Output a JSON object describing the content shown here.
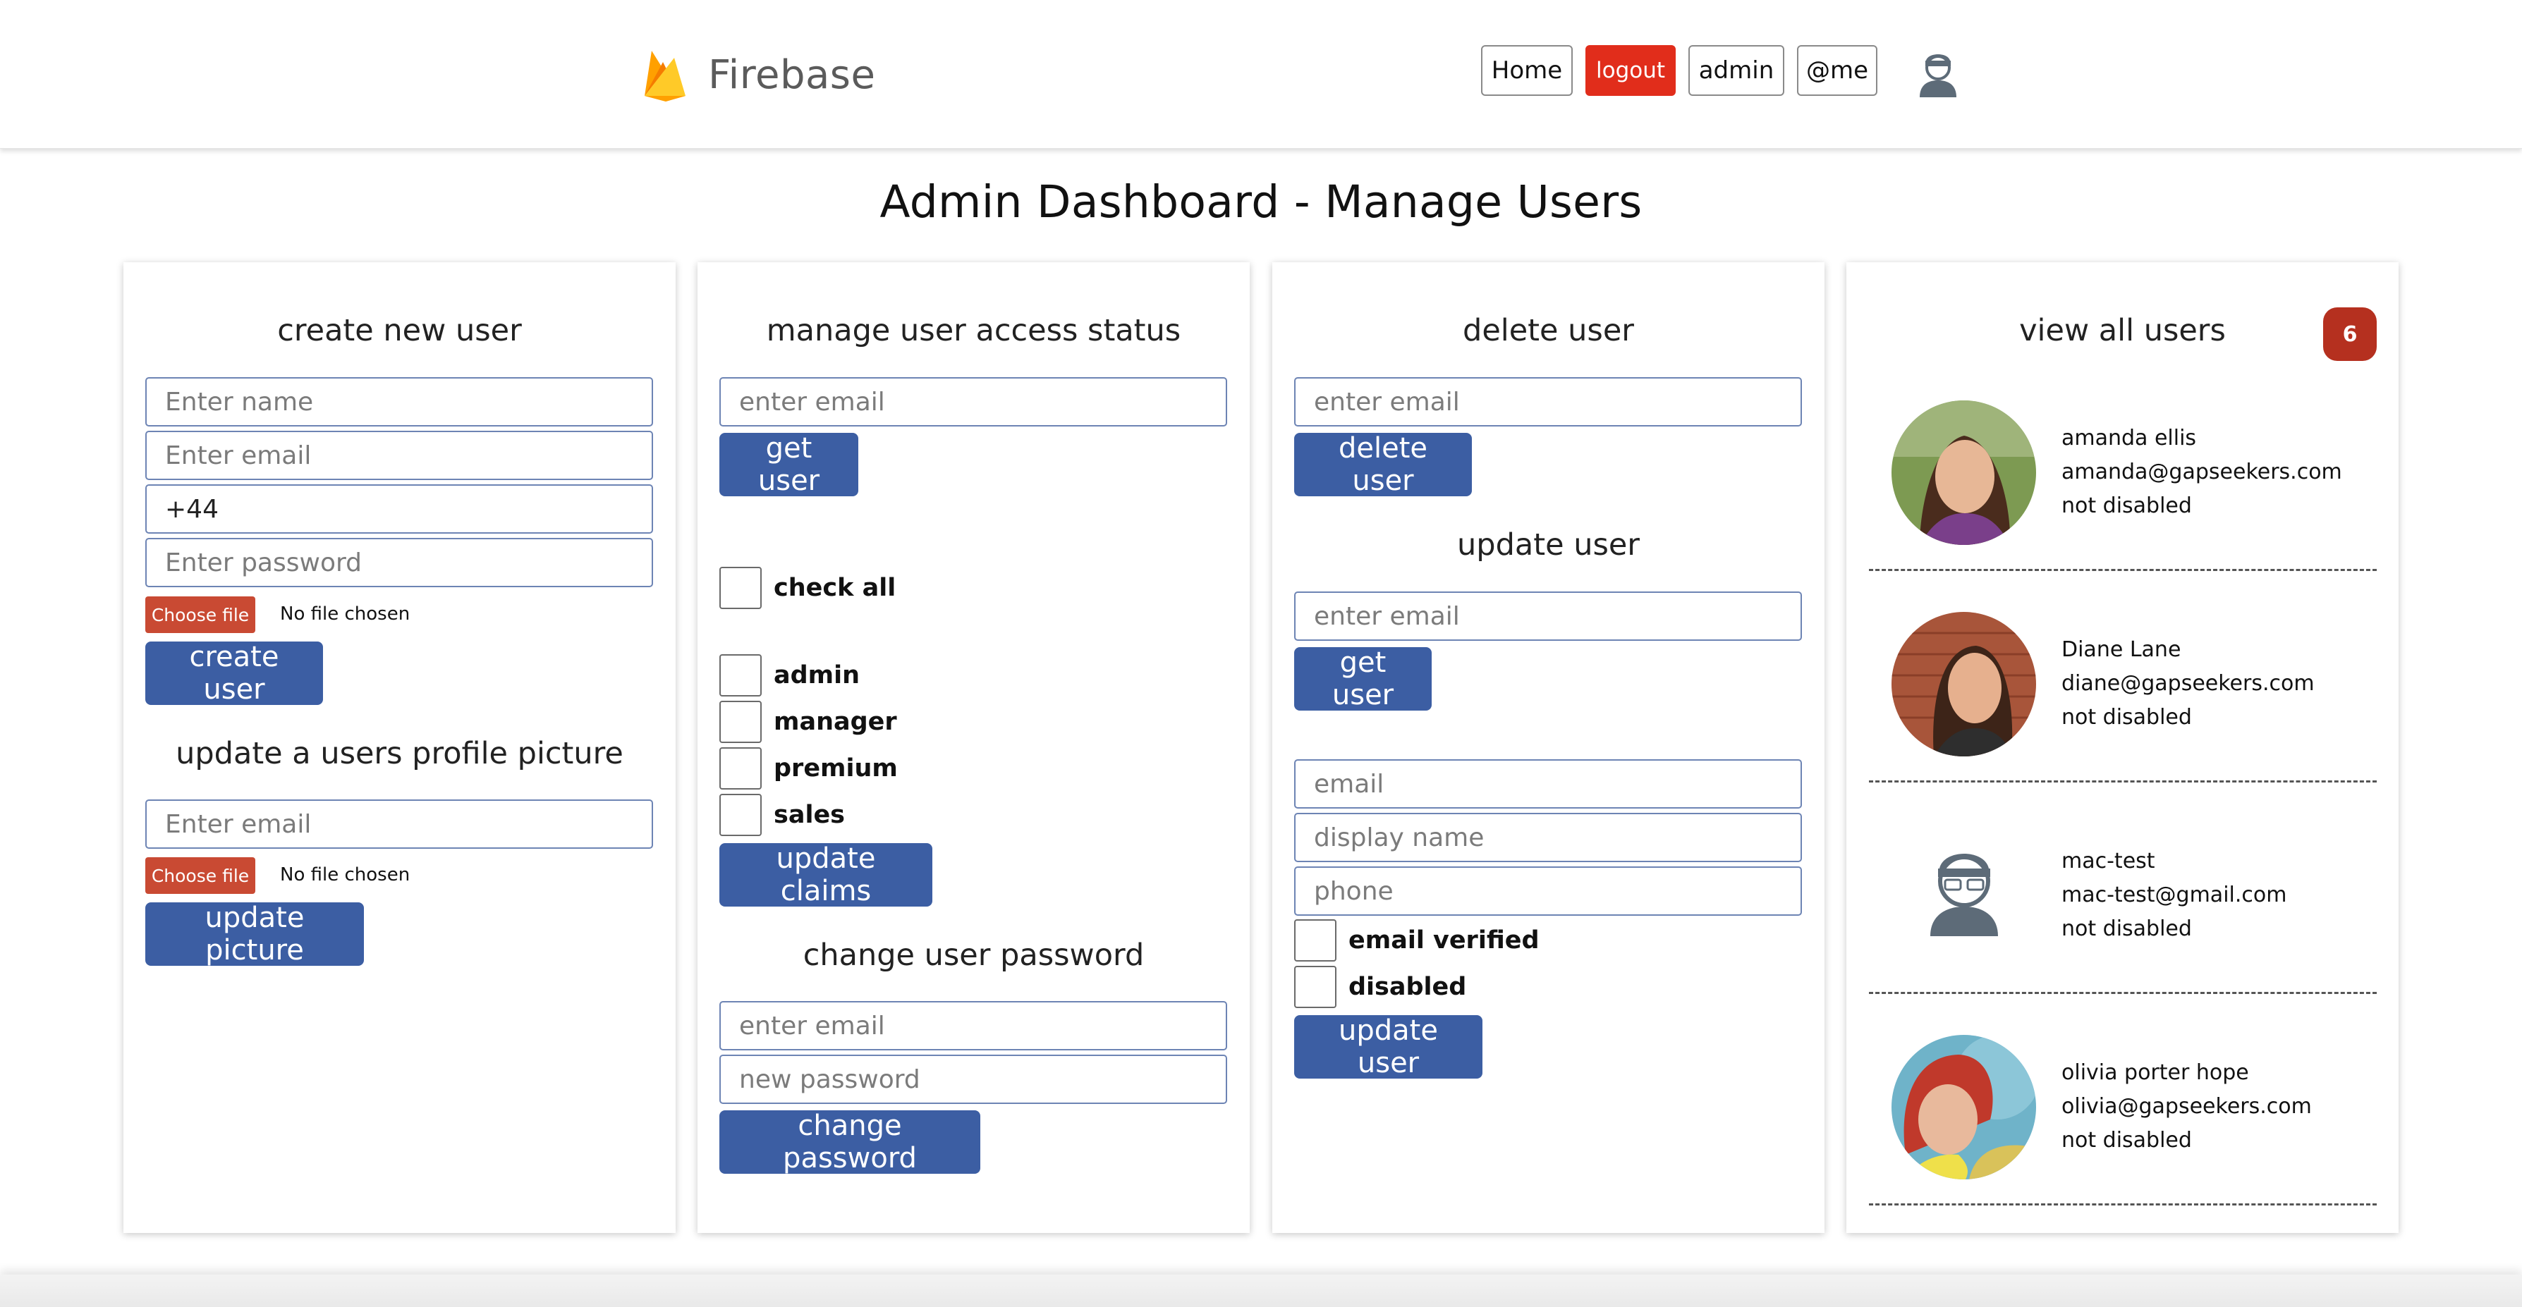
{
  "header": {
    "brand": "Firebase",
    "nav": {
      "home": "Home",
      "logout": "logout",
      "admin": "admin",
      "me": "@me"
    },
    "colors": {
      "logout_bg": "#e12d1b"
    }
  },
  "page_title": "Admin Dashboard - Manage Users",
  "create_card": {
    "title": "create new user",
    "name_placeholder": "Enter name",
    "email_placeholder": "Enter email",
    "phone_value": "+44",
    "password_placeholder": "Enter password",
    "file_button": "Choose file",
    "file_status": "No file chosen",
    "create_button": "create user",
    "picture_title": "update a users profile picture",
    "picture_email_placeholder": "Enter email",
    "picture_file_button": "Choose file",
    "picture_file_status": "No file chosen",
    "picture_button": "update picture"
  },
  "access_card": {
    "title": "manage user access status",
    "email_placeholder": "enter email",
    "get_button": "get user",
    "check_all": "check all",
    "claims": [
      "admin",
      "manager",
      "premium",
      "sales"
    ],
    "update_claims_button": "update claims",
    "password_title": "change user password",
    "pw_email_placeholder": "enter email",
    "pw_new_placeholder": "new password",
    "change_password_button": "change password"
  },
  "delete_card": {
    "title": "delete user",
    "email_placeholder": "enter email",
    "delete_button": "delete user",
    "update_title": "update user",
    "update_email_placeholder": "enter email",
    "get_button": "get user",
    "field_email_placeholder": "email",
    "field_display_name_placeholder": "display name",
    "field_phone_placeholder": "phone",
    "email_verified_label": "email verified",
    "disabled_label": "disabled",
    "update_button": "update user"
  },
  "users_card": {
    "title": "view all users",
    "count": "6",
    "users": [
      {
        "name": "amanda ellis",
        "email": "amanda@gapseekers.com",
        "status": "not disabled",
        "photo": "photo"
      },
      {
        "name": "Diane Lane",
        "email": "diane@gapseekers.com",
        "status": "not disabled",
        "photo": "photo"
      },
      {
        "name": "mac-test",
        "email": "mac-test@gmail.com",
        "status": "not disabled",
        "photo": "default-avatar-icon"
      },
      {
        "name": "olivia porter hope",
        "email": "olivia@gapseekers.com",
        "status": "not disabled",
        "photo": "photo"
      }
    ]
  },
  "colors": {
    "primary_button": "#3c5ea3",
    "file_button": "#c94a33",
    "badge": "#b5301f",
    "input_border": "#6d84b4"
  }
}
